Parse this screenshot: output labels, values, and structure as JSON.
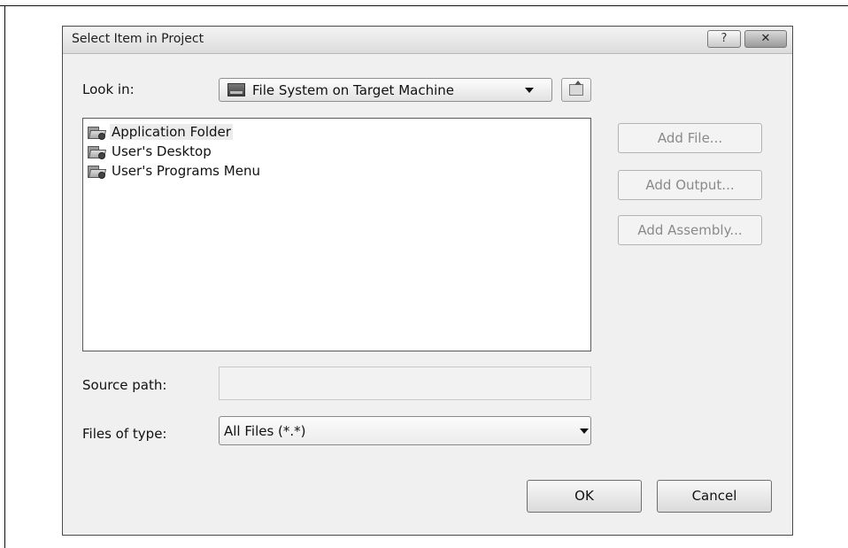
{
  "dialog": {
    "title": "Select Item in Project",
    "help_label": "?",
    "close_label": "✕"
  },
  "look_in": {
    "label": "Look in:",
    "value": "File System on Target Machine",
    "icon": "machine-icon"
  },
  "file_list": {
    "items": [
      {
        "label": "Application Folder",
        "icon": "special-folder-icon",
        "selected": true
      },
      {
        "label": "User's Desktop",
        "icon": "special-folder-icon",
        "selected": false
      },
      {
        "label": "User's Programs Menu",
        "icon": "special-folder-icon",
        "selected": false
      }
    ]
  },
  "side_buttons": {
    "add_file": "Add File...",
    "add_output": "Add Output...",
    "add_assembly": "Add Assembly..."
  },
  "source_path": {
    "label": "Source path:",
    "value": ""
  },
  "files_of_type": {
    "label": "Files of type:",
    "value": "All Files (*.*)"
  },
  "buttons": {
    "ok": "OK",
    "cancel": "Cancel"
  }
}
